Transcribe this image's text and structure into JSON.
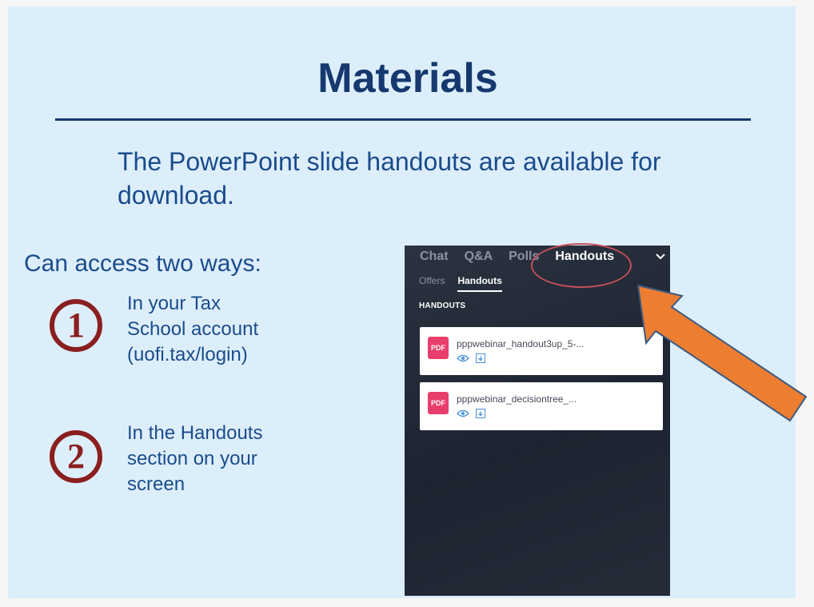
{
  "slide": {
    "title": "Materials",
    "intro": "The PowerPoint slide handouts are available for download.",
    "access_heading": "Can access two ways:",
    "ways": [
      {
        "number": "1",
        "lines": [
          "In your Tax",
          "School account",
          "(uofi.tax/login)"
        ]
      },
      {
        "number": "2",
        "lines": [
          "In the Handouts",
          "section on your",
          "screen"
        ]
      }
    ]
  },
  "panel": {
    "tabs": [
      {
        "label": "Chat",
        "active": false
      },
      {
        "label": "Q&A",
        "active": false
      },
      {
        "label": "Polls",
        "active": false
      },
      {
        "label": "Handouts",
        "active": true
      }
    ],
    "collapse_icon": "chevron-down-icon",
    "subtabs": [
      {
        "label": "Offers",
        "active": false
      },
      {
        "label": "Handouts",
        "active": true
      }
    ],
    "section_label": "HANDOUTS",
    "files": [
      {
        "type_label": "PDF",
        "name": "pppwebinar_handout3up_5-..."
      },
      {
        "type_label": "PDF",
        "name": "pppwebinar_decisiontree_..."
      }
    ]
  },
  "colors": {
    "slide_background": "#ddeefb",
    "title": "#15386e",
    "body_text": "#1a4c8c",
    "number_circle": "#8a1f1f",
    "panel_background": "#1d2330",
    "pdf_badge": "#e83e6b",
    "highlight_circle": "#c4505a",
    "arrow": "#ed7d31"
  }
}
